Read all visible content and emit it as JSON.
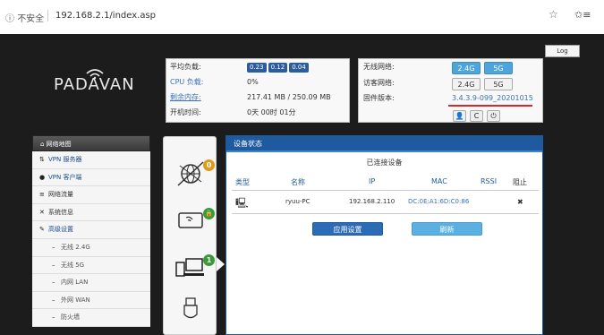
{
  "browser": {
    "security": "不安全",
    "url": "192.168.2.1/index.asp"
  },
  "header": {
    "logout": "Log",
    "logo": "PADAVAN"
  },
  "stats": {
    "load_label": "平均负载:",
    "load_values": [
      "0.23",
      "0.12",
      "0.04"
    ],
    "cpu_label": "CPU 负载:",
    "cpu_value": "0%",
    "mem_label": "剩余内存:",
    "mem_value": "217.41 MB / 250.09 MB",
    "uptime_label": "开机时间:",
    "uptime_value": "0天 00时 01分"
  },
  "network": {
    "wireless_label": "无线网络:",
    "guest_label": "访客网络:",
    "firmware_label": "固件版本:",
    "firmware_value": "3.4.3.9-099_20201015",
    "band_24": "2.4G",
    "band_5": "5G"
  },
  "menu": {
    "header": "网络地图",
    "items": [
      {
        "icon": "⇅",
        "label": "VPN 服务器",
        "main": true
      },
      {
        "icon": "●",
        "label": "VPN 客户端",
        "main": true
      },
      {
        "icon": "≡",
        "label": "网络流量",
        "main": false
      },
      {
        "icon": "✕",
        "label": "系统信息",
        "main": false
      },
      {
        "icon": "✎",
        "label": "高级设置",
        "main": true
      },
      {
        "icon": "–",
        "label": "无线 2.4G",
        "sub": true
      },
      {
        "icon": "–",
        "label": "无线 5G",
        "sub": true
      },
      {
        "icon": "–",
        "label": "内网 LAN",
        "sub": true
      },
      {
        "icon": "–",
        "label": "外网 WAN",
        "sub": true
      },
      {
        "icon": "–",
        "label": "防火墙",
        "sub": true
      }
    ]
  },
  "devices": {
    "panel_title": "设备状态",
    "subtitle": "已连接设备",
    "columns": [
      "类型",
      "名称",
      "IP",
      "MAC",
      "RSSI",
      "阻止"
    ],
    "rows": [
      {
        "name": "ryuu-PC",
        "ip": "192.168.2.110",
        "mac": "DC:0E:A1:6D:C0:86",
        "rssi": "",
        "block": "✖"
      }
    ],
    "apply_button": "应用设置",
    "refresh_button": "刷新",
    "badges": {
      "internet": "0",
      "client": "1"
    }
  },
  "colors": {
    "accent": "#1e5b9e",
    "band_on": "#4ea5dc",
    "warning": "#e09a1a",
    "ok": "#3a9a3a"
  }
}
